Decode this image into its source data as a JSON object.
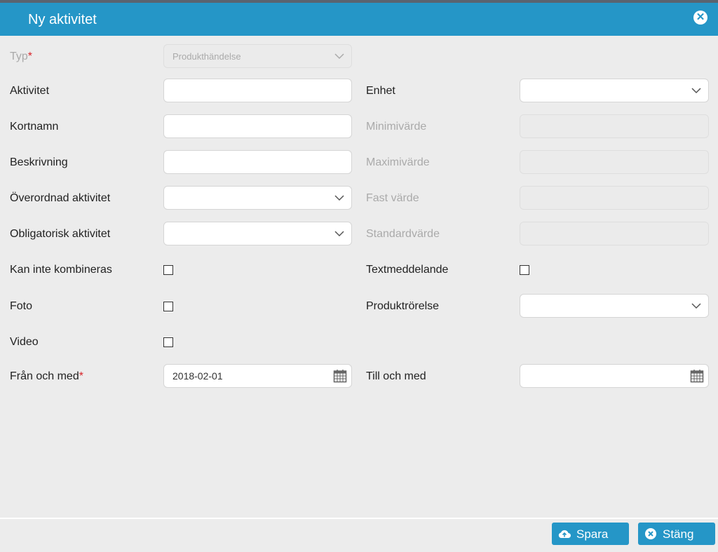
{
  "dialog": {
    "title": "Ny aktivitet"
  },
  "form": {
    "typ": {
      "label": "Typ",
      "required_mark": "*",
      "value": "Produkthändelse"
    },
    "aktivitet": {
      "label": "Aktivitet",
      "value": ""
    },
    "kortnamn": {
      "label": "Kortnamn",
      "value": ""
    },
    "beskrivning": {
      "label": "Beskrivning",
      "value": ""
    },
    "overordnad": {
      "label": "Överordnad aktivitet",
      "value": ""
    },
    "obligatorisk": {
      "label": "Obligatorisk aktivitet",
      "value": ""
    },
    "kan_inte": {
      "label": "Kan inte kombineras",
      "checked": false
    },
    "foto": {
      "label": "Foto",
      "checked": false
    },
    "video": {
      "label": "Video",
      "checked": false
    },
    "fran": {
      "label": "Från och med",
      "required_mark": "*",
      "value": "2018-02-01"
    },
    "enhet": {
      "label": "Enhet",
      "value": ""
    },
    "minimivarde": {
      "label": "Minimivärde",
      "value": ""
    },
    "maximivarde": {
      "label": "Maximivärde",
      "value": ""
    },
    "fast_varde": {
      "label": "Fast värde",
      "value": ""
    },
    "standardvarde": {
      "label": "Standardvärde",
      "value": ""
    },
    "textmeddelande": {
      "label": "Textmeddelande",
      "checked": false
    },
    "produktrorelse": {
      "label": "Produktrörelse",
      "value": ""
    },
    "till": {
      "label": "Till och med",
      "value": ""
    }
  },
  "footer": {
    "save_label": "Spara",
    "close_label": "Stäng"
  },
  "colors": {
    "accent": "#2596c7",
    "required": "#d9252b",
    "background": "#ececec"
  },
  "icons": [
    "close-icon",
    "chevron-down-icon",
    "calendar-icon",
    "cloud-upload-icon",
    "close-circle-icon"
  ]
}
